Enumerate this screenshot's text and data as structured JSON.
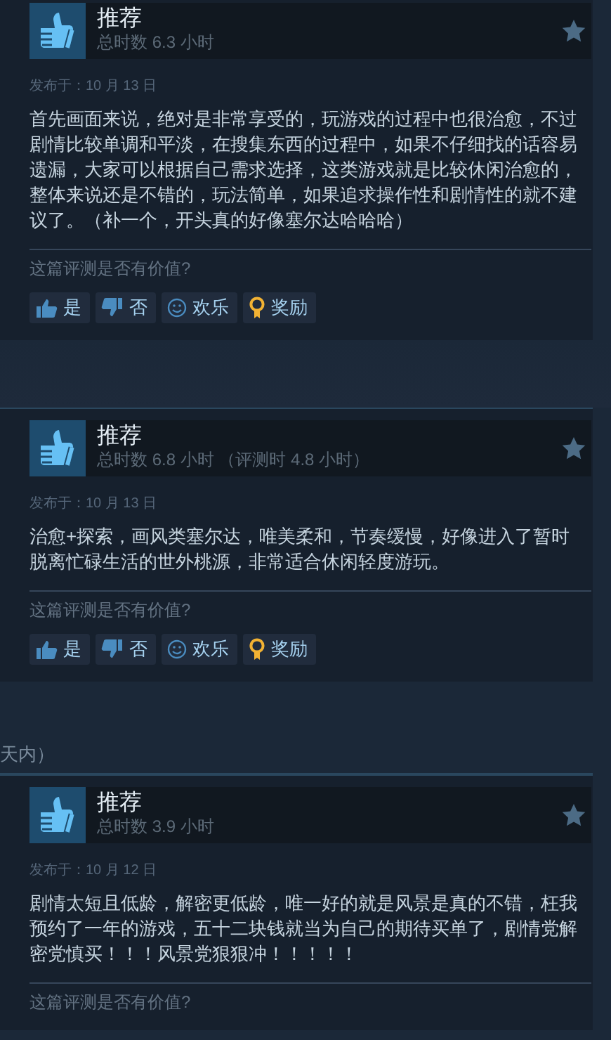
{
  "sections": [
    {
      "reviews": [
        {
          "title": "推荐",
          "playtime": "总时数 6.3 小时",
          "posted": "发布于：10 月 13 日",
          "body": "首先画面来说，绝对是非常享受的，玩游戏的过程中也很治愈，不过剧情比较单调和平淡，在搜集东西的过程中，如果不仔细找的话容易遗漏，大家可以根据自己需求选择，这类游戏就是比较休闲治愈的，整体来说还是不错的，玩法简单，如果追求操作性和剧情性的就不建议了。（补一个，开头真的好像塞尔达哈哈哈）",
          "helpful_prompt": "这篇评测是否有价值?",
          "buttons": [
            {
              "kind": "yes",
              "label": "是"
            },
            {
              "kind": "no",
              "label": "否"
            },
            {
              "kind": "funny",
              "label": "欢乐"
            },
            {
              "kind": "award",
              "label": "奖励"
            }
          ]
        },
        {
          "title": "推荐",
          "playtime": "总时数 6.8 小时 （评测时 4.8 小时）",
          "posted": "发布于：10 月 13 日",
          "body": "治愈+探索，画风类塞尔达，唯美柔和，节奏缓慢，好像进入了暂时脱离忙碌生活的世外桃源，非常适合休闲轻度游玩。",
          "helpful_prompt": "这篇评测是否有价值?",
          "buttons": [
            {
              "kind": "yes",
              "label": "是"
            },
            {
              "kind": "no",
              "label": "否"
            },
            {
              "kind": "funny",
              "label": "欢乐"
            },
            {
              "kind": "award",
              "label": "奖励"
            }
          ]
        }
      ]
    },
    {
      "heading": "天内）",
      "reviews": [
        {
          "title": "推荐",
          "playtime": "总时数 3.9 小时",
          "posted": "发布于：10 月 12 日",
          "body": "剧情太短且低龄，解密更低龄，唯一好的就是风景是真的不错，枉我预约了一年的游戏，五十二块钱就当为自己的期待买单了，剧情党解密党慎买！！！风景党狠狠冲！！！！！",
          "helpful_prompt": "这篇评测是否有价值?"
        }
      ]
    }
  ]
}
